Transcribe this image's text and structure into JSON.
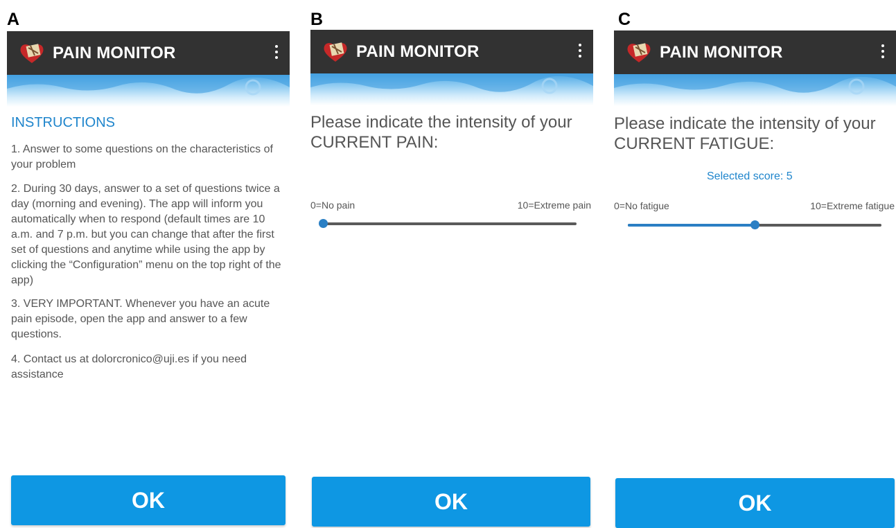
{
  "panels": [
    {
      "letter": "A",
      "app_title": "PAIN MONITOR",
      "instructions_title": "INSTRUCTIONS",
      "instructions": [
        "1. Answer to some questions on the characteristics of your problem",
        "2. During 30 days, answer to a set of questions twice a day (morning and evening). The app will inform you automatically when to respond (default times are 10 a.m. and 7 p.m. but you can change that after the first set of questions and anytime while using the app by clicking the “Configuration” menu on the top right of the app)",
        "3. VERY IMPORTANT. Whenever you have an acute pain episode, open the app and answer to a few questions.",
        "4. Contact us at dolorcronico@uji.es if you need assistance"
      ],
      "ok_label": "OK"
    },
    {
      "letter": "B",
      "app_title": "PAIN MONITOR",
      "question": "Please indicate the intensity of your CURRENT PAIN:",
      "min_label": "0=No pain",
      "max_label": "10=Extreme pain",
      "slider_value": 0,
      "slider_max": 10,
      "ok_label": "OK"
    },
    {
      "letter": "C",
      "app_title": "PAIN MONITOR",
      "question": "Please indicate the intensity of your CURRENT FATIGUE:",
      "selected_score": "Selected score: 5",
      "min_label": "0=No fatigue",
      "max_label": "10=Extreme fatigue",
      "slider_value": 5,
      "slider_max": 10,
      "ok_label": "OK"
    }
  ],
  "icons": {
    "logo": "heart-map-logo-icon",
    "menu": "more-vert-icon"
  },
  "colors": {
    "appbar": "#323232",
    "accent": "#1f85cc",
    "ok_button": "#0e97e3",
    "slider": "#2a7fc4"
  }
}
